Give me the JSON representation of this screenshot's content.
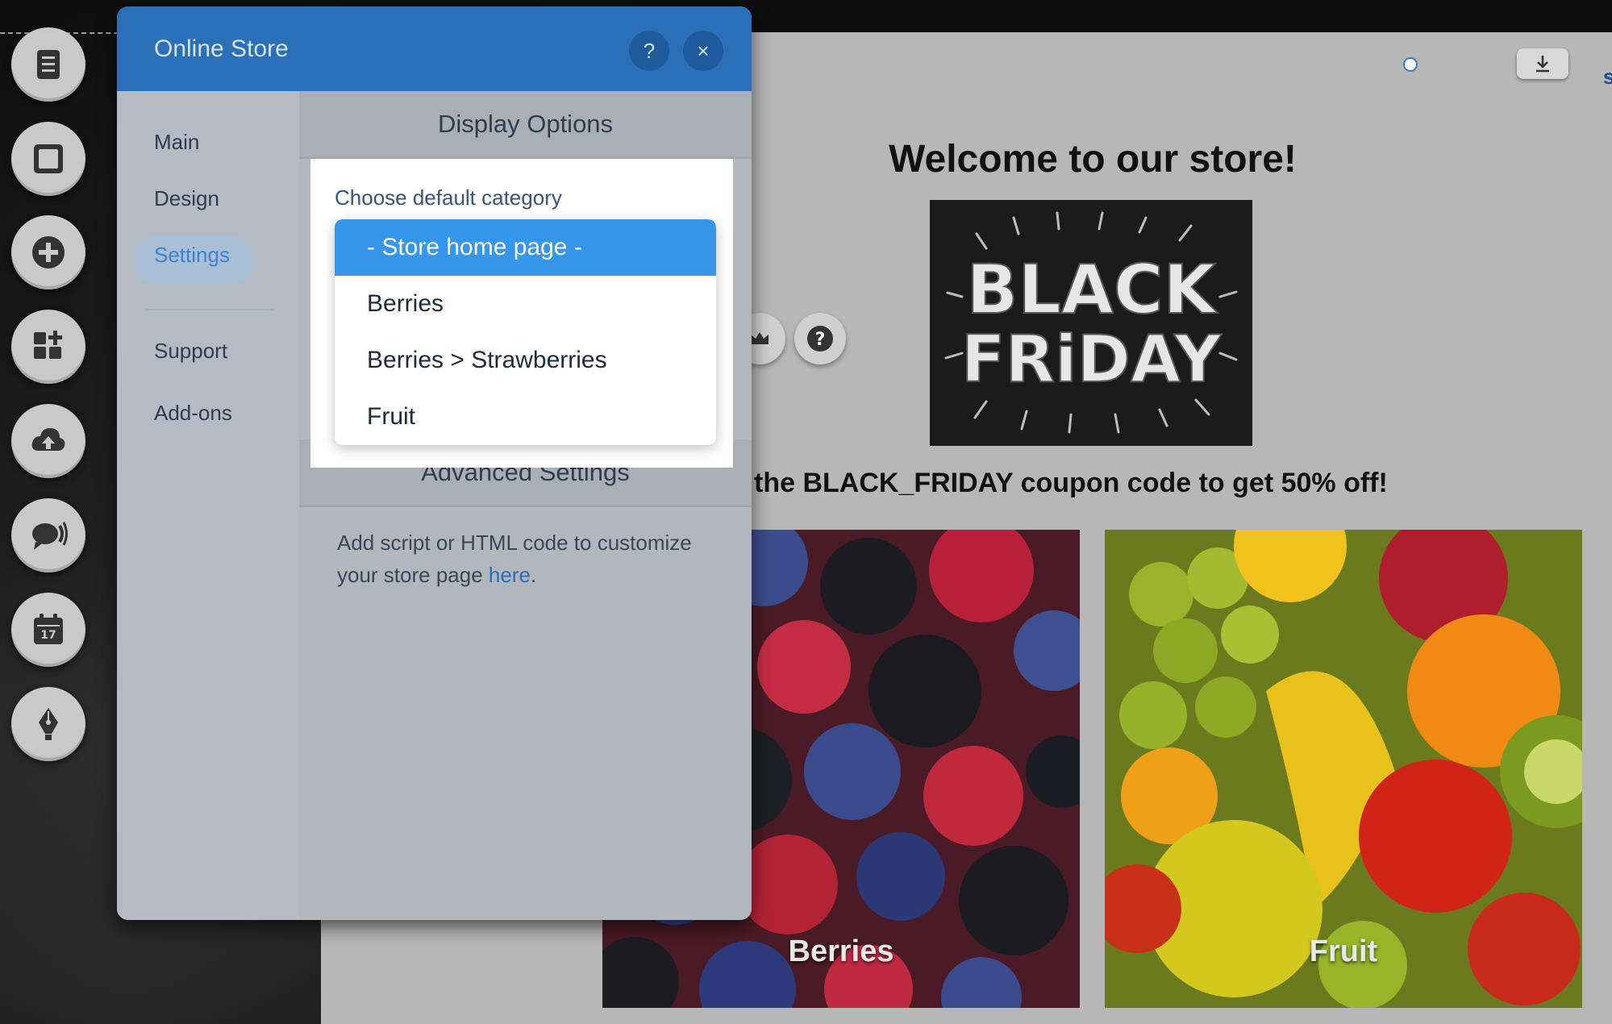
{
  "panel": {
    "title": "Online Store",
    "help_label": "?",
    "close_label": "×",
    "nav": [
      {
        "label": "Main",
        "active": false
      },
      {
        "label": "Design",
        "active": false
      },
      {
        "label": "Settings",
        "active": true
      },
      {
        "label": "Support",
        "active": false
      },
      {
        "label": "Add-ons",
        "active": false
      }
    ],
    "display_options_header": "Display Options",
    "choose_category_label": "Choose default category",
    "category_options": [
      {
        "label": "- Store home page -",
        "selected": true
      },
      {
        "label": "Berries",
        "selected": false
      },
      {
        "label": "Berries > Strawberries",
        "selected": false
      },
      {
        "label": "Fruit",
        "selected": false
      }
    ],
    "advanced_settings_header": "Advanced Settings",
    "advanced_text_before": "Add script or HTML code to customize your store page ",
    "advanced_link": "here",
    "advanced_text_after": "."
  },
  "toolbar": {
    "icons": [
      "pages-icon",
      "background-icon",
      "add-icon",
      "app-market-icon",
      "upload-icon",
      "chat-icon",
      "calendar-icon",
      "blog-pen-icon"
    ],
    "calendar_day": "17"
  },
  "site": {
    "welcome_title": "Welcome to our store!",
    "banner_line1": "BLACK",
    "banner_line2": "FRiDAY",
    "coupon_text": "the BLACK_FRIDAY coupon code to get 50% off!",
    "help_float_label": "?",
    "edge_text": "s",
    "categories": [
      {
        "label": "Berries"
      },
      {
        "label": "Fruit"
      }
    ]
  },
  "colors": {
    "header_blue": "#2b6fb8",
    "selected_blue": "#3596ea",
    "link_blue": "#2b6fb8"
  }
}
